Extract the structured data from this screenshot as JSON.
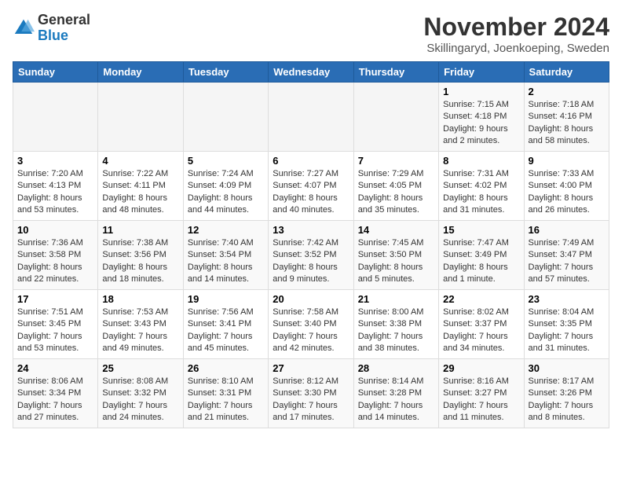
{
  "header": {
    "logo_general": "General",
    "logo_blue": "Blue",
    "month_title": "November 2024",
    "location": "Skillingaryd, Joenkoeping, Sweden"
  },
  "calendar": {
    "weekdays": [
      "Sunday",
      "Monday",
      "Tuesday",
      "Wednesday",
      "Thursday",
      "Friday",
      "Saturday"
    ],
    "weeks": [
      [
        {
          "day": "",
          "info": ""
        },
        {
          "day": "",
          "info": ""
        },
        {
          "day": "",
          "info": ""
        },
        {
          "day": "",
          "info": ""
        },
        {
          "day": "",
          "info": ""
        },
        {
          "day": "1",
          "info": "Sunrise: 7:15 AM\nSunset: 4:18 PM\nDaylight: 9 hours\nand 2 minutes."
        },
        {
          "day": "2",
          "info": "Sunrise: 7:18 AM\nSunset: 4:16 PM\nDaylight: 8 hours\nand 58 minutes."
        }
      ],
      [
        {
          "day": "3",
          "info": "Sunrise: 7:20 AM\nSunset: 4:13 PM\nDaylight: 8 hours\nand 53 minutes."
        },
        {
          "day": "4",
          "info": "Sunrise: 7:22 AM\nSunset: 4:11 PM\nDaylight: 8 hours\nand 48 minutes."
        },
        {
          "day": "5",
          "info": "Sunrise: 7:24 AM\nSunset: 4:09 PM\nDaylight: 8 hours\nand 44 minutes."
        },
        {
          "day": "6",
          "info": "Sunrise: 7:27 AM\nSunset: 4:07 PM\nDaylight: 8 hours\nand 40 minutes."
        },
        {
          "day": "7",
          "info": "Sunrise: 7:29 AM\nSunset: 4:05 PM\nDaylight: 8 hours\nand 35 minutes."
        },
        {
          "day": "8",
          "info": "Sunrise: 7:31 AM\nSunset: 4:02 PM\nDaylight: 8 hours\nand 31 minutes."
        },
        {
          "day": "9",
          "info": "Sunrise: 7:33 AM\nSunset: 4:00 PM\nDaylight: 8 hours\nand 26 minutes."
        }
      ],
      [
        {
          "day": "10",
          "info": "Sunrise: 7:36 AM\nSunset: 3:58 PM\nDaylight: 8 hours\nand 22 minutes."
        },
        {
          "day": "11",
          "info": "Sunrise: 7:38 AM\nSunset: 3:56 PM\nDaylight: 8 hours\nand 18 minutes."
        },
        {
          "day": "12",
          "info": "Sunrise: 7:40 AM\nSunset: 3:54 PM\nDaylight: 8 hours\nand 14 minutes."
        },
        {
          "day": "13",
          "info": "Sunrise: 7:42 AM\nSunset: 3:52 PM\nDaylight: 8 hours\nand 9 minutes."
        },
        {
          "day": "14",
          "info": "Sunrise: 7:45 AM\nSunset: 3:50 PM\nDaylight: 8 hours\nand 5 minutes."
        },
        {
          "day": "15",
          "info": "Sunrise: 7:47 AM\nSunset: 3:49 PM\nDaylight: 8 hours\nand 1 minute."
        },
        {
          "day": "16",
          "info": "Sunrise: 7:49 AM\nSunset: 3:47 PM\nDaylight: 7 hours\nand 57 minutes."
        }
      ],
      [
        {
          "day": "17",
          "info": "Sunrise: 7:51 AM\nSunset: 3:45 PM\nDaylight: 7 hours\nand 53 minutes."
        },
        {
          "day": "18",
          "info": "Sunrise: 7:53 AM\nSunset: 3:43 PM\nDaylight: 7 hours\nand 49 minutes."
        },
        {
          "day": "19",
          "info": "Sunrise: 7:56 AM\nSunset: 3:41 PM\nDaylight: 7 hours\nand 45 minutes."
        },
        {
          "day": "20",
          "info": "Sunrise: 7:58 AM\nSunset: 3:40 PM\nDaylight: 7 hours\nand 42 minutes."
        },
        {
          "day": "21",
          "info": "Sunrise: 8:00 AM\nSunset: 3:38 PM\nDaylight: 7 hours\nand 38 minutes."
        },
        {
          "day": "22",
          "info": "Sunrise: 8:02 AM\nSunset: 3:37 PM\nDaylight: 7 hours\nand 34 minutes."
        },
        {
          "day": "23",
          "info": "Sunrise: 8:04 AM\nSunset: 3:35 PM\nDaylight: 7 hours\nand 31 minutes."
        }
      ],
      [
        {
          "day": "24",
          "info": "Sunrise: 8:06 AM\nSunset: 3:34 PM\nDaylight: 7 hours\nand 27 minutes."
        },
        {
          "day": "25",
          "info": "Sunrise: 8:08 AM\nSunset: 3:32 PM\nDaylight: 7 hours\nand 24 minutes."
        },
        {
          "day": "26",
          "info": "Sunrise: 8:10 AM\nSunset: 3:31 PM\nDaylight: 7 hours\nand 21 minutes."
        },
        {
          "day": "27",
          "info": "Sunrise: 8:12 AM\nSunset: 3:30 PM\nDaylight: 7 hours\nand 17 minutes."
        },
        {
          "day": "28",
          "info": "Sunrise: 8:14 AM\nSunset: 3:28 PM\nDaylight: 7 hours\nand 14 minutes."
        },
        {
          "day": "29",
          "info": "Sunrise: 8:16 AM\nSunset: 3:27 PM\nDaylight: 7 hours\nand 11 minutes."
        },
        {
          "day": "30",
          "info": "Sunrise: 8:17 AM\nSunset: 3:26 PM\nDaylight: 7 hours\nand 8 minutes."
        }
      ]
    ]
  }
}
